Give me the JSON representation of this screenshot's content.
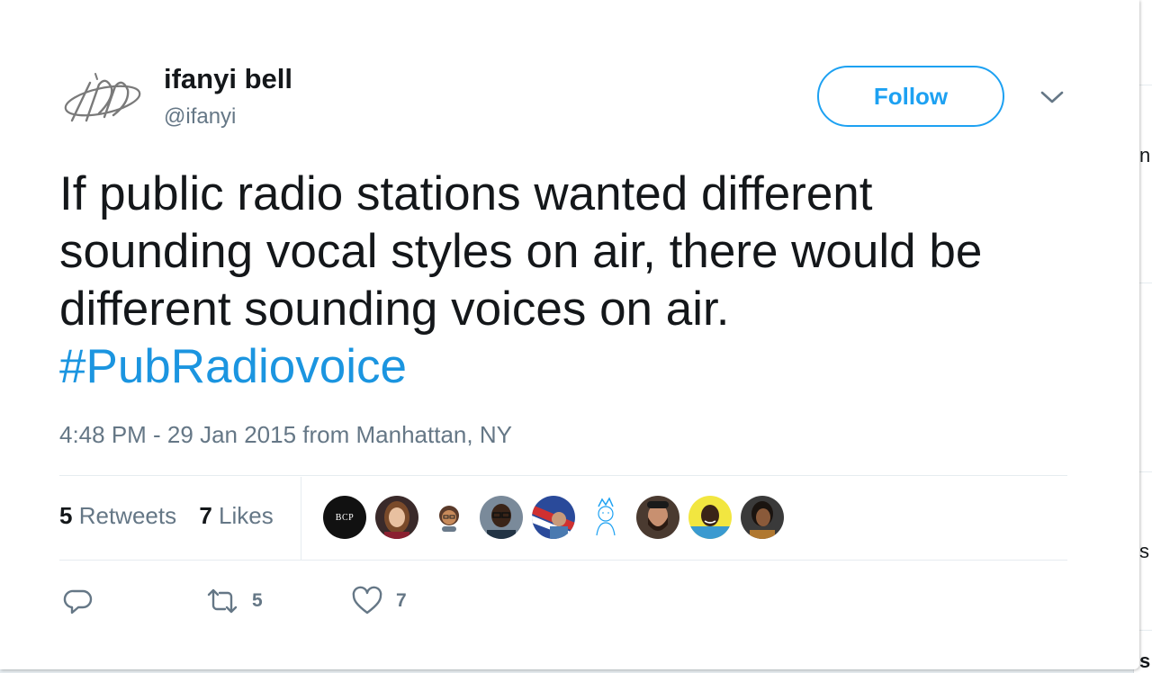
{
  "user": {
    "display_name": "ifanyi bell",
    "handle": "@ifanyi"
  },
  "follow_label": "Follow",
  "tweet": {
    "lines": [
      "If public radio stations wanted different",
      "sounding vocal styles on air, there would be",
      "different sounding voices on air."
    ],
    "hashtag": "#PubRadiovoice",
    "timestamp": "4:48 PM - 29 Jan 2015 from Manhattan, NY"
  },
  "stats": {
    "retweets_count": "5",
    "retweets_label": "Retweets",
    "likes_count": "7",
    "likes_label": "Likes"
  },
  "likers_avatars": [
    {
      "name": "bcp-avatar",
      "text": "BCP"
    },
    {
      "name": "woman-avatar"
    },
    {
      "name": "cartoon-avatar"
    },
    {
      "name": "man-glasses-avatar"
    },
    {
      "name": "flag-avatar"
    },
    {
      "name": "sketch-avatar"
    },
    {
      "name": "bearded-man-avatar"
    },
    {
      "name": "yellow-avatar"
    },
    {
      "name": "woman-dark-avatar"
    }
  ],
  "actions": {
    "reply_icon": "reply-icon",
    "retweet_icon": "retweet-icon",
    "retweet_count": "5",
    "like_icon": "heart-icon",
    "like_count": "7"
  },
  "backdrop_fragments": [
    "n",
    "s",
    "s"
  ],
  "colors": {
    "accent": "#1da1f2",
    "hashtag": "#1b95e0",
    "text": "#14171a",
    "secondary": "#657786",
    "border": "#e6ecf0"
  }
}
